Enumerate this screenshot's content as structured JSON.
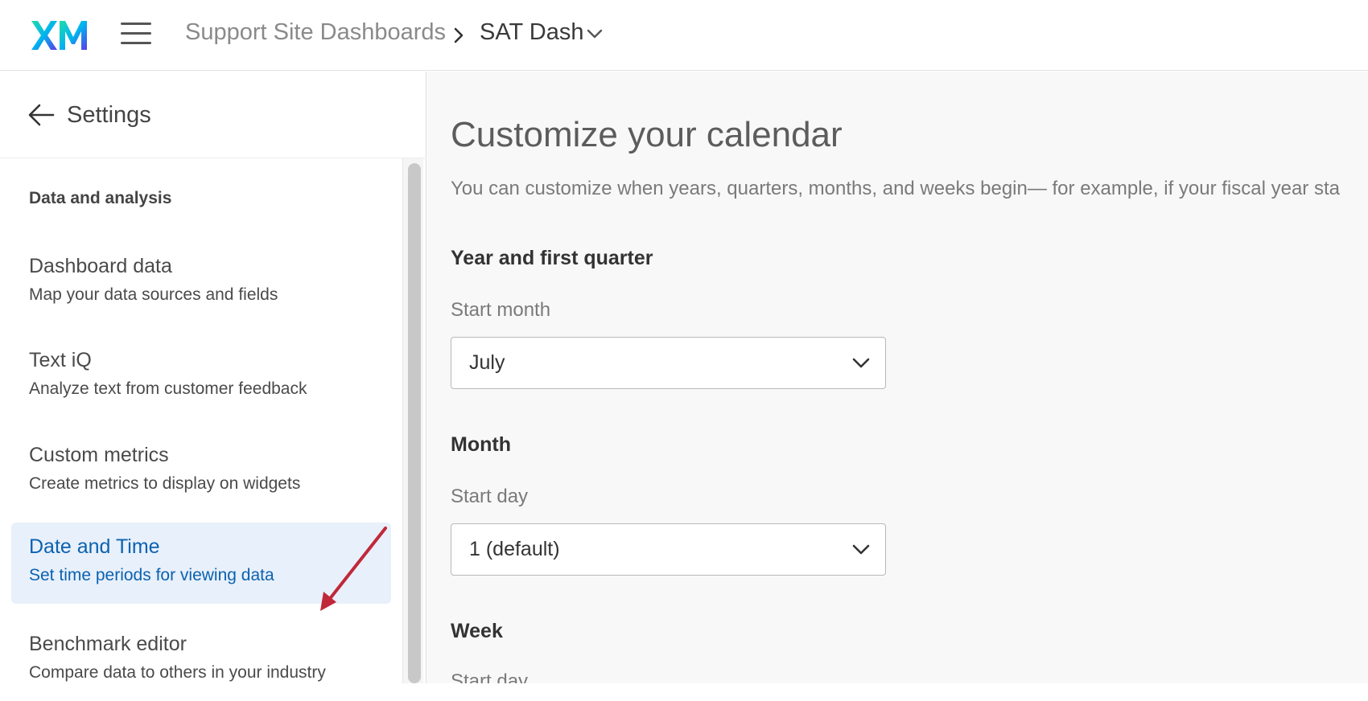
{
  "header": {
    "breadcrumb_root": "Support Site Dashboards",
    "breadcrumb_current": "SAT Dash"
  },
  "sidebar": {
    "title": "Settings",
    "section_label": "Data and analysis",
    "items": [
      {
        "title": "Dashboard data",
        "desc": "Map your data sources and fields"
      },
      {
        "title": "Text iQ",
        "desc": "Analyze text from customer feedback"
      },
      {
        "title": "Custom metrics",
        "desc": "Create metrics to display on widgets"
      },
      {
        "title": "Date and Time",
        "desc": "Set time periods for viewing data"
      },
      {
        "title": "Benchmark editor",
        "desc": "Compare data to others in your industry"
      }
    ]
  },
  "main": {
    "heading": "Customize your calendar",
    "intro": "You can customize when years, quarters, months, and weeks begin— for example, if your fiscal year sta",
    "year": {
      "title": "Year and first quarter",
      "label": "Start month",
      "value": "July"
    },
    "month": {
      "title": "Month",
      "label": "Start day",
      "value": "1 (default)"
    },
    "week": {
      "title": "Week",
      "label": "Start day"
    }
  },
  "colors": {
    "accent": "#0b62b0",
    "active_bg": "#e8f0fb",
    "annotation": "#c0283a"
  }
}
